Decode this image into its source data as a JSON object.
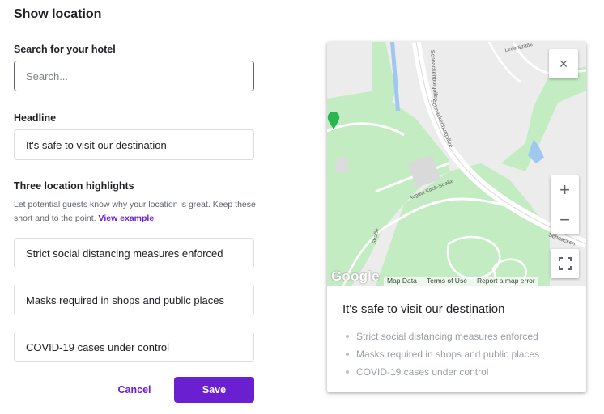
{
  "page": {
    "title": "Show location"
  },
  "search": {
    "label": "Search for your hotel",
    "placeholder": "Search...",
    "value": ""
  },
  "headline": {
    "label": "Headline",
    "value": "It's safe to visit our destination"
  },
  "highlights": {
    "label": "Three location highlights",
    "help_text": "Let potential guests know why your location is great. Keep these short and to the point.",
    "help_link": "View example",
    "items": [
      "Strict social distancing measures enforced",
      "Masks required in shops and public places",
      "COVID-19 cases under control"
    ]
  },
  "actions": {
    "cancel_label": "Cancel",
    "save_label": "Save"
  },
  "preview": {
    "headline": "It's safe to visit our destination",
    "items": [
      "Strict social distancing measures enforced",
      "Masks required in shops and public places",
      "COVID-19 cases under control"
    ],
    "map": {
      "logo": "Google",
      "footer": [
        "Map Data",
        "Terms of Use",
        "Report a map error"
      ],
      "streets": [
        "Schnackenburgallee",
        "Schnackenburgallee",
        "August-Kirch-Straße",
        "Lederstraße",
        "Schnacken",
        "Straße"
      ],
      "controls": {
        "close": "×",
        "zoom_in": "+",
        "zoom_out": "−"
      }
    }
  },
  "colors": {
    "accent": "#6a1fd0",
    "park": "#c3ecc3",
    "road": "#ffffff",
    "water": "#9fc7f0"
  },
  "icons": [
    "close-icon",
    "zoom-in-icon",
    "zoom-out-icon",
    "fullscreen-icon",
    "park-marker-icon"
  ]
}
